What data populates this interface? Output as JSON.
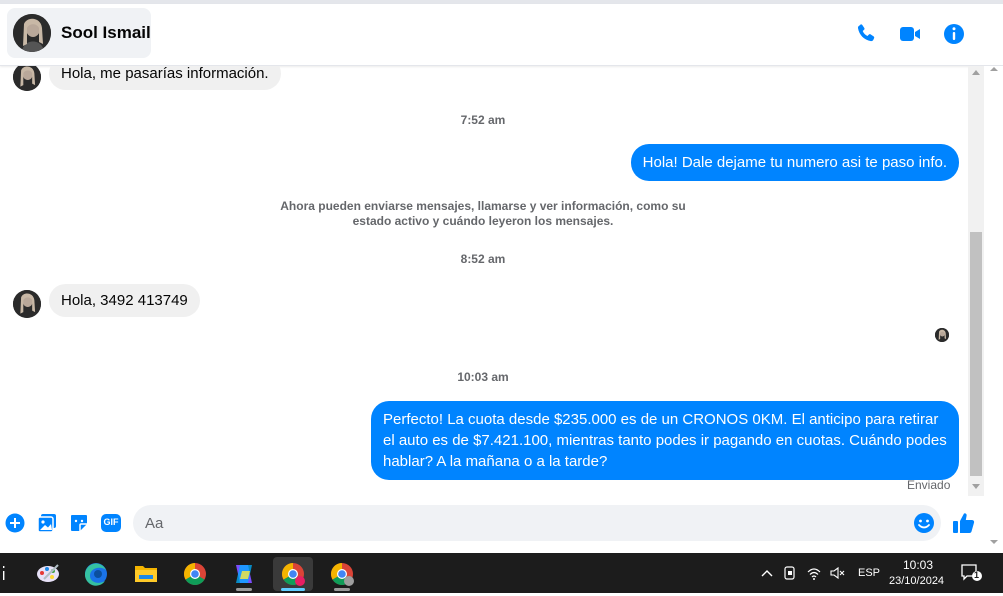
{
  "header": {
    "contact_name": "Sool Ismail",
    "icons": [
      "phone-icon",
      "video-camera-icon",
      "info-icon"
    ],
    "accent_color": "#0084ff"
  },
  "thread": {
    "messages": [
      {
        "direction": "incoming",
        "text": "Hola, me pasarías información."
      },
      {
        "type": "timestamp",
        "text": "7:52 am"
      },
      {
        "direction": "outgoing",
        "text": "Hola! Dale  dejame tu numero asi te paso info."
      },
      {
        "type": "system",
        "text": "Ahora pueden enviarse mensajes, llamarse y ver información, como su estado activo y cuándo leyeron los mensajes."
      },
      {
        "type": "timestamp",
        "text": "8:52 am"
      },
      {
        "direction": "incoming",
        "text": "Hola, 3492 413749"
      },
      {
        "type": "timestamp",
        "text": "10:03 am"
      },
      {
        "direction": "outgoing",
        "text": "Perfecto! La cuota desde $235.000 es de un CRONOS 0KM. El anticipo para retirar el auto es de $7.421.100, mientras tanto podes ir pagando en cuotas. Cuándo podes hablar? A la mañana o a la tarde?"
      }
    ],
    "delivery_status": "Enviado"
  },
  "composer": {
    "placeholder": "Aa",
    "value": "",
    "gif_label": "GIF",
    "icons": [
      "plus-icon",
      "image-icon",
      "sticker-icon",
      "gif-icon",
      "emoji-icon",
      "thumbs-up-icon"
    ]
  },
  "taskbar": {
    "apps": [
      "paint-icon",
      "edge-icon",
      "file-explorer-icon",
      "chrome-icon",
      "copilot-icon",
      "chrome-profile-c-icon",
      "chrome-profile-2-icon"
    ],
    "language": "ESP",
    "time": "10:03",
    "date": "23/10/2024",
    "notification_count": "1"
  }
}
